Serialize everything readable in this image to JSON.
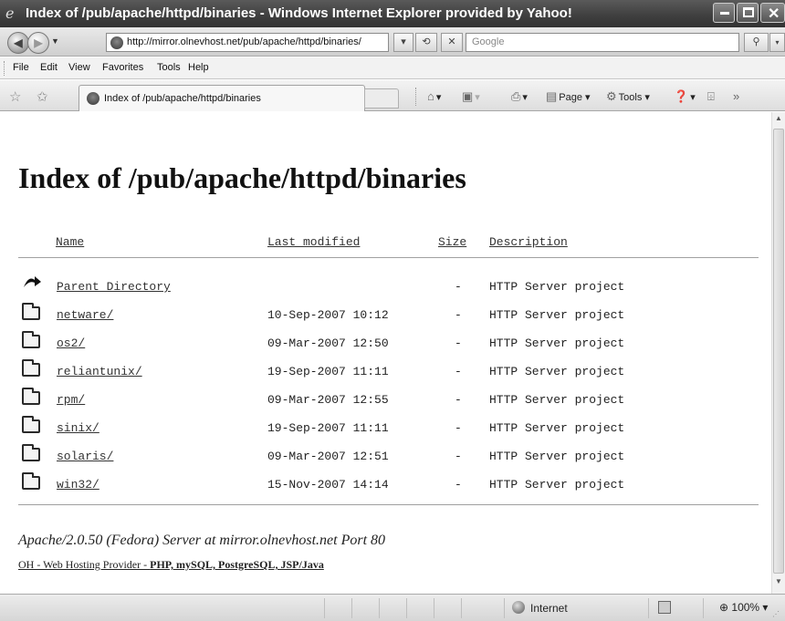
{
  "window": {
    "title": "Index of /pub/apache/httpd/binaries - Windows Internet Explorer provided by Yahoo!"
  },
  "toolbar": {
    "address_url": "http://mirror.olnevhost.net/pub/apache/httpd/binaries/",
    "search_placeholder": "Google"
  },
  "menu": [
    "File",
    "Edit",
    "View",
    "Favorites",
    "Tools",
    "Help"
  ],
  "tab": {
    "label": "Index of /pub/apache/httpd/binaries"
  },
  "command_bar": {
    "page_label": "Page",
    "tools_label": "Tools"
  },
  "page": {
    "heading": "Index of /pub/apache/httpd/binaries",
    "columns": [
      "Name",
      "Last modified",
      "Size",
      "Description"
    ],
    "rows": [
      {
        "icon": "parent-directory-icon",
        "name": "Parent Directory",
        "modified": "",
        "size": "-",
        "description": "HTTP Server project"
      },
      {
        "icon": "folder-icon",
        "name": "netware/",
        "modified": "10-Sep-2007 10:12",
        "size": "-",
        "description": "HTTP Server project"
      },
      {
        "icon": "folder-icon",
        "name": "os2/",
        "modified": "09-Mar-2007 12:50",
        "size": "-",
        "description": "HTTP Server project"
      },
      {
        "icon": "folder-icon",
        "name": "reliantunix/",
        "modified": "19-Sep-2007 11:11",
        "size": "-",
        "description": "HTTP Server project"
      },
      {
        "icon": "folder-icon",
        "name": "rpm/",
        "modified": "09-Mar-2007 12:55",
        "size": "-",
        "description": "HTTP Server project"
      },
      {
        "icon": "folder-icon",
        "name": "sinix/",
        "modified": "19-Sep-2007 11:11",
        "size": "-",
        "description": "HTTP Server project"
      },
      {
        "icon": "folder-icon",
        "name": "solaris/",
        "modified": "09-Mar-2007 12:51",
        "size": "-",
        "description": "HTTP Server project"
      },
      {
        "icon": "folder-icon",
        "name": "win32/",
        "modified": "15-Nov-2007 14:14",
        "size": "-",
        "description": "HTTP Server project"
      }
    ],
    "server_signature": "Apache/2.0.50 (Fedora) Server at mirror.olnevhost.net Port 80",
    "footer_link_prefix": "OH - Web Hosting Provider - ",
    "footer_link_bold": "PHP, mySQL, PostgreSQL, JSP/Java"
  },
  "status_bar": {
    "zone": "Internet",
    "zoom": "100%"
  }
}
